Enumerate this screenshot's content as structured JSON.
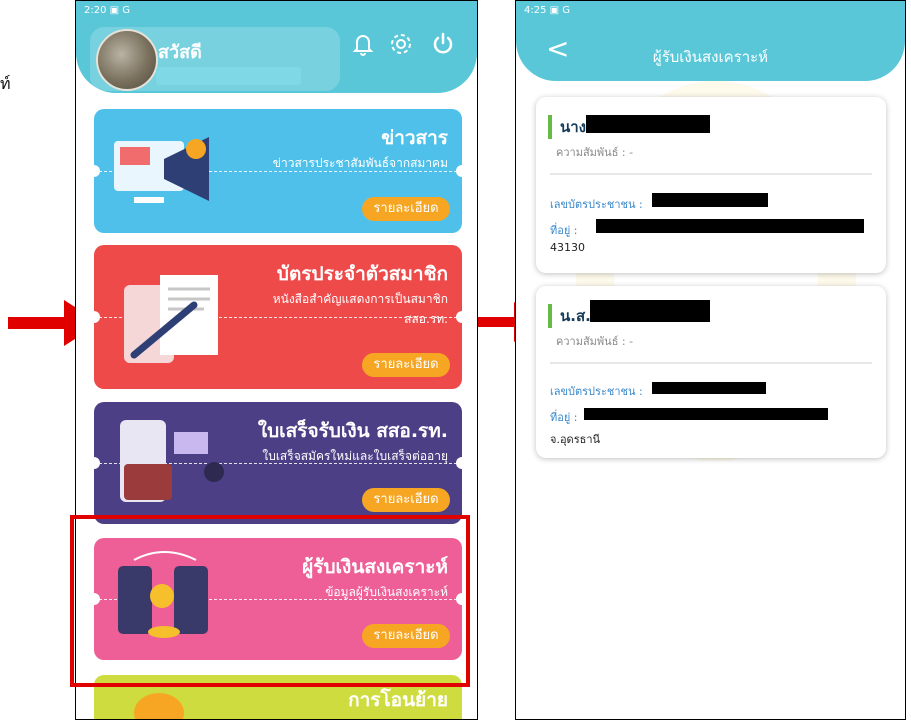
{
  "caption": "ท์",
  "left": {
    "status": "2:20  ▣ G",
    "greeting": "สวัสดี",
    "cards": [
      {
        "title": "ข่าวสาร",
        "subtitle": "ข่าวสารประชาสัมพันธ์จากสมาคม",
        "button": "รายละเอียด",
        "color": "#4fc0ea"
      },
      {
        "title": "บัตรประจำตัวสมาชิก",
        "subtitle": "หนังสือสำคัญแสดงการเป็นสมาชิก สสอ.รท.",
        "button": "รายละเอียด",
        "color": "#ee4a4a"
      },
      {
        "title": "ใบเสร็จรับเงิน สสอ.รท.",
        "subtitle": "ใบเสร็จสมัครใหม่และใบเสร็จต่ออายุ",
        "button": "รายละเอียด",
        "color": "#4d3f86"
      },
      {
        "title": "ผู้รับเงินสงเคราะห์",
        "subtitle": "ข้อมูลผู้รับเงินสงเคราะห์",
        "button": "รายละเอียด",
        "color": "#ee5f97"
      },
      {
        "title": "การโอนย้าย",
        "subtitle": "",
        "button": "",
        "color": "#cfdc3f"
      }
    ]
  },
  "right": {
    "status": "4:25  ▣ G",
    "back": "<",
    "title": "ผู้รับเงินสงเคราะห์",
    "records": [
      {
        "prefix": "นาง",
        "relation": "ความสัมพันธ์ : -",
        "id_label": "เลขบัตรประชาชน :",
        "addr_label": "ที่อยู่ :",
        "addr_tail": "43130"
      },
      {
        "prefix": "น.ส.",
        "relation": "ความสัมพันธ์ : -",
        "id_label": "เลขบัตรประชาชน :",
        "addr_label": "ที่อยู่ :",
        "addr_tail": "จ.อุดรธานี"
      }
    ]
  },
  "colors": {
    "header": "#59c7d8",
    "button": "#f6a623",
    "highlight": "#e00000",
    "arrow": "#e00000"
  }
}
